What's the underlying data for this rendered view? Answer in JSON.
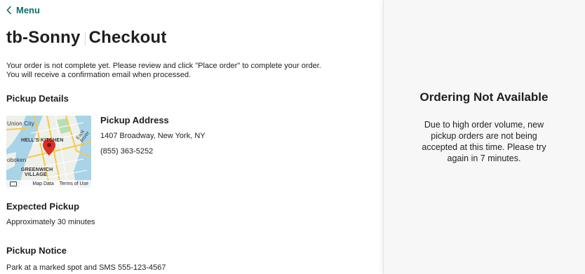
{
  "nav": {
    "menu_label": "Menu"
  },
  "page": {
    "title_left": "tb-Sonny",
    "title_right": "Checkout",
    "intro_line1": "Your order is not complete yet. Please review and click \"Place order\" to complete your order.",
    "intro_line2": "You will receive a confirmation email when processed."
  },
  "pickup_details": {
    "heading": "Pickup Details",
    "address_heading": "Pickup Address",
    "address": "1407 Broadway, New York, NY",
    "phone": "(855) 363-5252",
    "map": {
      "labels": [
        "Union City",
        "HELL'S KITCHEN",
        "oboken",
        "GREENWICH",
        "VILLAGE",
        "East River"
      ],
      "footer_map_data": "Map Data",
      "footer_terms": "Terms of Use",
      "pin_color": "#d93025"
    }
  },
  "expected_pickup": {
    "heading": "Expected Pickup",
    "value": "Approximately 30 minutes"
  },
  "pickup_notice": {
    "heading": "Pickup Notice",
    "value": "Park at a marked spot and SMS 555-123-4567"
  },
  "availability": {
    "title": "Ordering Not Available",
    "message": "Due to high order volume, new pickup orders are not being accepted at this time. Please try again in 7 minutes."
  },
  "colors": {
    "accent": "#0e6e6a",
    "panel_bg": "#f7f7f7"
  }
}
